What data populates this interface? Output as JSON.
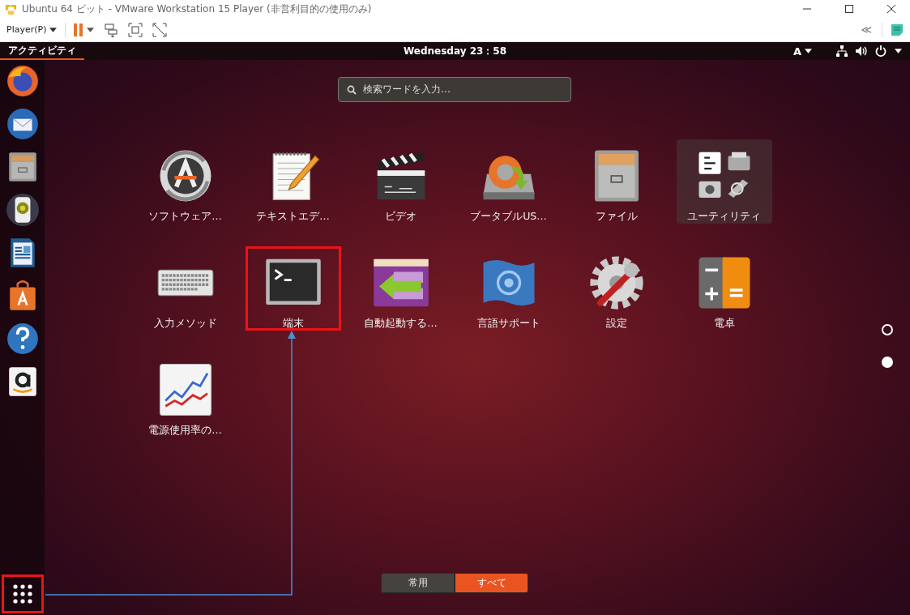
{
  "window": {
    "title": "Ubuntu 64 ビット - VMware Workstation 15 Player (非営利目的の使用のみ)"
  },
  "toolbar": {
    "player_menu": "Player(P)",
    "collapse_toggle": "≪"
  },
  "top_bar": {
    "activities": "アクティビティ",
    "clock": "Wednesday 23：58",
    "input_method": "A"
  },
  "dock": {
    "show_apps": {
      "highlighted": true
    }
  },
  "search": {
    "placeholder": "検索ワードを入力…"
  },
  "apps": [
    {
      "label": "ソフトウェア…",
      "kind": "app",
      "highlighted": false
    },
    {
      "label": "テキストエデ…",
      "kind": "app",
      "highlighted": false
    },
    {
      "label": "ビデオ",
      "kind": "app",
      "highlighted": false
    },
    {
      "label": "ブータブルUS…",
      "kind": "app",
      "highlighted": false
    },
    {
      "label": "ファイル",
      "kind": "app",
      "highlighted": false
    },
    {
      "label": "ユーティリティ",
      "kind": "folder",
      "highlighted": false
    },
    {
      "label": "入力メソッド",
      "kind": "app",
      "highlighted": false
    },
    {
      "label": "端末",
      "kind": "app",
      "highlighted": true
    },
    {
      "label": "自動起動する…",
      "kind": "app",
      "highlighted": false
    },
    {
      "label": "言語サポート",
      "kind": "app",
      "highlighted": false
    },
    {
      "label": "設定",
      "kind": "app",
      "highlighted": false
    },
    {
      "label": "電卓",
      "kind": "app",
      "highlighted": false
    },
    {
      "label": "電源使用率の…",
      "kind": "app",
      "highlighted": false
    }
  ],
  "pages": [
    {
      "selected": false
    },
    {
      "selected": true
    }
  ],
  "view_tabs": [
    {
      "label": "常用",
      "selected": false
    },
    {
      "label": "すべて",
      "selected": true
    }
  ]
}
